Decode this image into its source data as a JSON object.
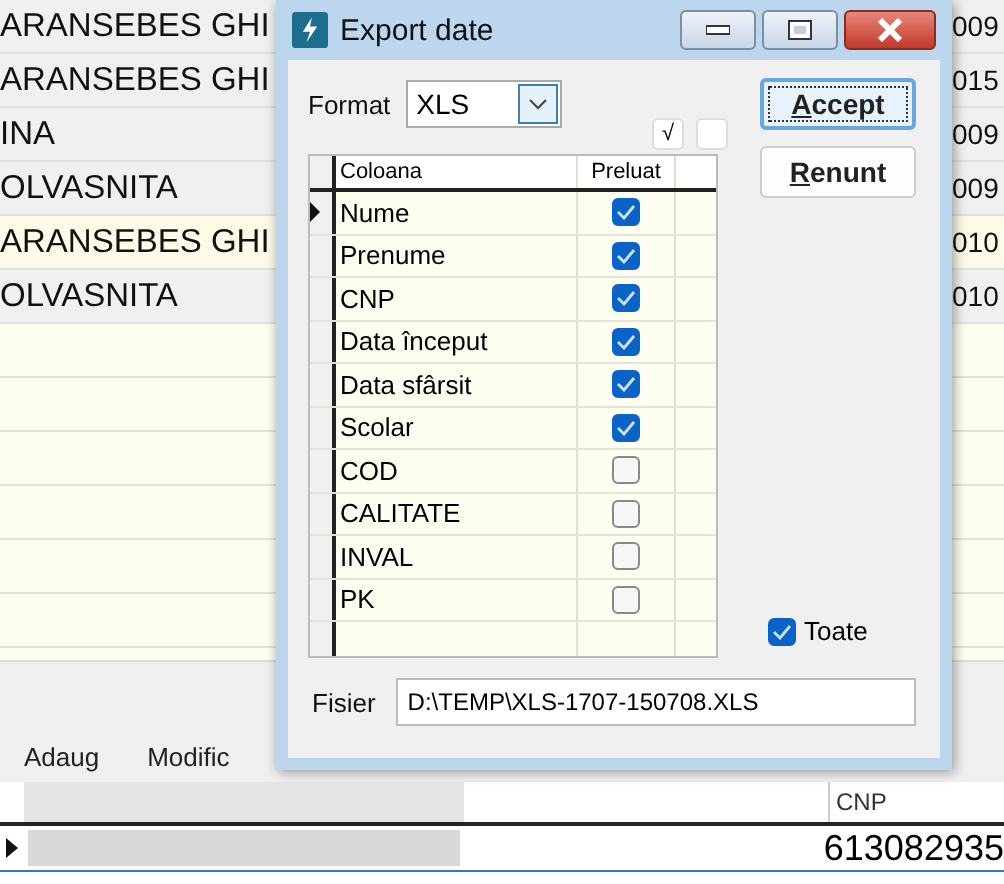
{
  "background": {
    "rows": [
      {
        "col_1": "ARANSEBES GHI",
        "col_2": "009",
        "selected": false
      },
      {
        "col_1": "ARANSEBES GHI",
        "col_2": "015",
        "selected": false
      },
      {
        "col_1": "INA",
        "col_2": "009",
        "selected": false
      },
      {
        "col_1": "OLVASNITA",
        "col_2": "009",
        "selected": false
      },
      {
        "col_1": "ARANSEBES GHI",
        "col_2": "010",
        "selected": true
      },
      {
        "col_1": "OLVASNITA",
        "col_2": "010",
        "selected": false
      }
    ],
    "toolbar": [
      "Adaug",
      "Modific"
    ],
    "lower_grid": {
      "column": "CNP",
      "cell": "613082935"
    }
  },
  "dialog": {
    "title": "Export date",
    "format": {
      "label": "Format",
      "value": "XLS"
    },
    "mark_buttons": [
      {
        "kind": "text",
        "label": "√"
      },
      {
        "kind": "blank"
      }
    ],
    "table": {
      "columns": [
        "Coloana",
        "Preluat"
      ],
      "rows": [
        {
          "name": "Nume",
          "checked": true,
          "current": true
        },
        {
          "name": "Prenume",
          "checked": true,
          "current": false
        },
        {
          "name": "CNP",
          "checked": true,
          "current": false
        },
        {
          "name": "Data început",
          "checked": true,
          "current": false
        },
        {
          "name": "Data sfârsit",
          "checked": true,
          "current": false
        },
        {
          "name": "Scolar",
          "checked": true,
          "current": false
        },
        {
          "name": "COD",
          "checked": false,
          "current": false
        },
        {
          "name": "CALITATE",
          "checked": false,
          "current": false
        },
        {
          "name": "INVAL",
          "checked": false,
          "current": false
        },
        {
          "name": "PK",
          "checked": false,
          "current": false
        }
      ]
    },
    "all": {
      "label": "Toate",
      "checked": true
    },
    "file": {
      "label": "Fisier",
      "value": "D:\\TEMP\\XLS-1707-150708.XLS"
    },
    "buttons": [
      "Accept",
      "Renunt"
    ]
  }
}
